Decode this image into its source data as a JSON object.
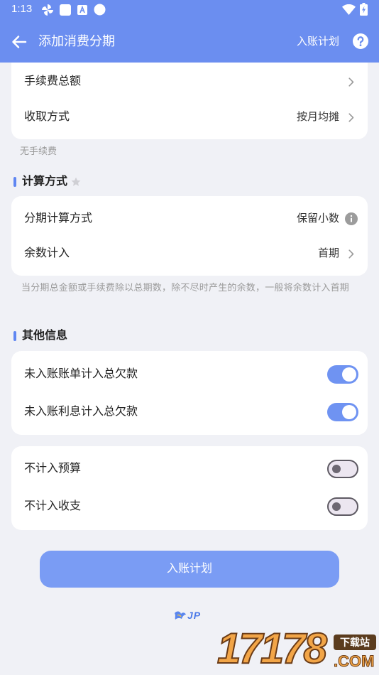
{
  "status_bar": {
    "time": "1:13",
    "icons": [
      "pinwheel-icon",
      "app-square-icon",
      "a-box-icon",
      "circle-icon",
      "wifi-icon",
      "battery-charging-icon"
    ]
  },
  "app_bar": {
    "title": "添加消费分期",
    "action_label": "入账计划",
    "icons": {
      "back": "back-arrow-icon",
      "help": "help-circle-icon"
    }
  },
  "fee_card": {
    "rows": [
      {
        "label": "手续费总额"
      },
      {
        "label": "收取方式",
        "value": "按月均摊"
      }
    ],
    "note": "无手续费"
  },
  "calc_section": {
    "title": "计算方式",
    "title_icon": "star-icon",
    "rows": [
      {
        "label": "分期计算方式",
        "value": "保留小数",
        "icon": "info-icon"
      },
      {
        "label": "余数计入",
        "value": "首期"
      }
    ],
    "note": "当分期总金额或手续费除以总期数，除不尽时产生的余数，一般将余数计入首期"
  },
  "other_section": {
    "title": "其他信息",
    "debt_card": [
      {
        "label": "未入账账单计入总欠款",
        "on": true
      },
      {
        "label": "未入账利息计入总欠款",
        "on": true
      }
    ],
    "exclude_card": [
      {
        "label": "不计入预算",
        "on": false
      },
      {
        "label": "不计入收支",
        "on": false
      }
    ]
  },
  "submit_button": {
    "label": "入账计划"
  },
  "logo": {
    "text": "JP"
  },
  "watermark": {
    "number": "17178",
    "site": "下载站",
    "domain": ".COM"
  },
  "colors": {
    "primary": "#6b8ef0",
    "toggle_on": "#6f93f2",
    "button": "#7a9cf4",
    "background": "#f0f1f6",
    "accent_bar": "#5f86f2"
  }
}
